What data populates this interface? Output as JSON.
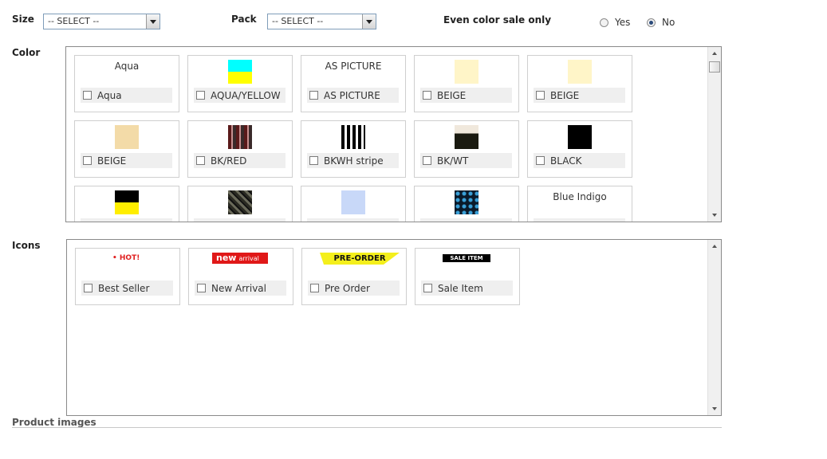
{
  "filters": {
    "size_label": "Size",
    "size_value": "-- SELECT --",
    "pack_label": "Pack",
    "pack_value": "-- SELECT --",
    "even_color_label": "Even color sale only",
    "yes_label": "Yes",
    "no_label": "No",
    "selected": "No"
  },
  "color": {
    "label": "Color",
    "items": [
      {
        "label": "Aqua",
        "swatch_text": "Aqua",
        "swatch": "text"
      },
      {
        "label": "AQUA/YELLOW",
        "swatch": "aqua-yellow",
        "top": "#00ffff",
        "bottom": "#ffff00"
      },
      {
        "label": "AS PICTURE",
        "swatch_text": "AS PICTURE",
        "swatch": "text"
      },
      {
        "label": "BEIGE",
        "swatch": "solid",
        "color": "#fff5c8"
      },
      {
        "label": "BEIGE",
        "swatch": "solid",
        "color": "#fff5c8"
      },
      {
        "label": "BEIGE",
        "swatch": "solid",
        "color": "#f3dba8"
      },
      {
        "label": "BK/RED",
        "swatch": "plaid"
      },
      {
        "label": "BKWH stripe",
        "swatch": "stripes"
      },
      {
        "label": "BK/WT",
        "swatch": "bkwt"
      },
      {
        "label": "BLACK",
        "swatch": "solid",
        "color": "#000000"
      },
      {
        "label": "",
        "swatch": "black-yellow",
        "top": "#000000",
        "bottom": "#ffee00"
      },
      {
        "label": "",
        "swatch": "texture"
      },
      {
        "label": "",
        "swatch": "solid",
        "color": "#c8d8f8"
      },
      {
        "label": "",
        "swatch": "dots"
      },
      {
        "label": "",
        "swatch_text": "Blue Indigo",
        "swatch": "text"
      }
    ]
  },
  "icons": {
    "label": "Icons",
    "items": [
      {
        "label": "Best Seller",
        "badge": "HOT!",
        "type": "hot"
      },
      {
        "label": "New Arrival",
        "badge": "new",
        "badge_sub": "arrival",
        "type": "new"
      },
      {
        "label": "Pre Order",
        "badge": "PRE-ORDER NOW!",
        "type": "pre"
      },
      {
        "label": "Sale Item",
        "badge": "SALE ITEM",
        "type": "sale"
      }
    ]
  },
  "product_images": {
    "label": "Product images"
  },
  "colors": {
    "border": "#8a8a8a",
    "bar": "#efefef",
    "tile_border": "#cfcfcf"
  }
}
